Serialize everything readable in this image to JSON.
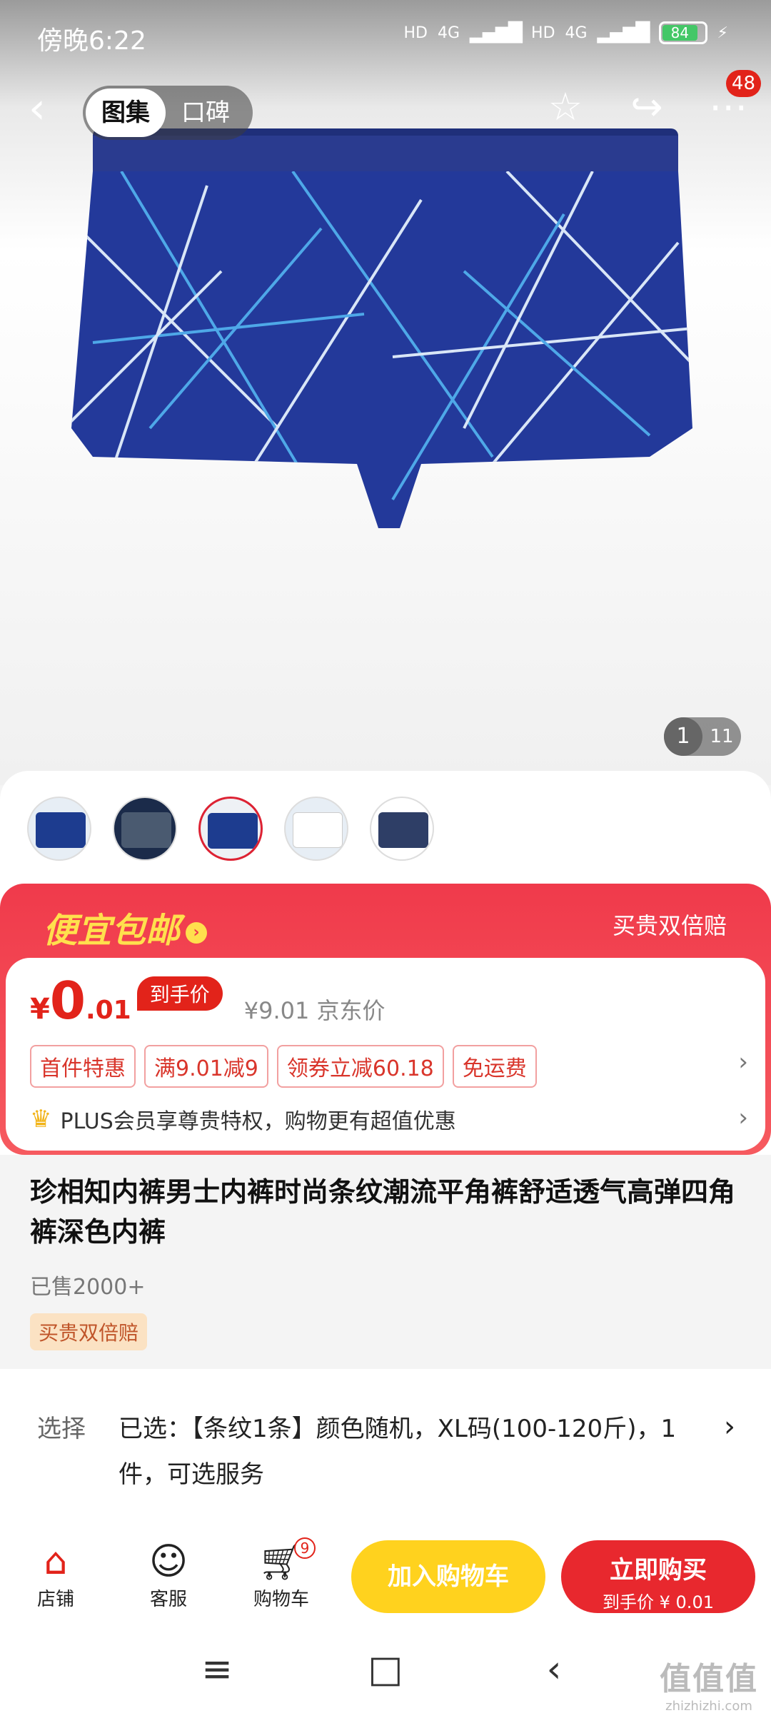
{
  "status": {
    "time": "傍晚6:22",
    "network1": "4G",
    "network2": "4G",
    "hd": "HD",
    "battery": "84"
  },
  "nav": {
    "back_icon": "back-arrow-icon",
    "tabs": [
      "图集",
      "口碑"
    ],
    "more_badge": "48"
  },
  "gallery": {
    "current": "1",
    "total": "11"
  },
  "promo": {
    "title": "便宜包邮",
    "right_text": "买贵双倍赔"
  },
  "price": {
    "yen": "¥",
    "integer": "0",
    "decimal": ".01",
    "pill": "到手价",
    "original": "¥9.01 京东价"
  },
  "tags": [
    "首件特惠",
    "满9.01减9",
    "领券立减60.18",
    "免运费"
  ],
  "plus_text": "PLUS会员享尊贵特权，购物更有超值优惠",
  "product": {
    "title": "珍相知内裤男士内裤时尚条纹潮流平角裤舒适透气高弹四角裤深色内裤",
    "sold": "已售2000+",
    "guarantee": "买贵双倍赔"
  },
  "selection": {
    "label": "选择",
    "text": "已选：【条纹1条】颜色随机，XL码(100-120斤)，1件，可选服务"
  },
  "bottom": {
    "shop": "店铺",
    "service": "客服",
    "cart": "购物车",
    "cart_count": "9",
    "add_cart": "加入购物车",
    "buy_now": "立即购买",
    "buy_sub": "到手价 ¥ 0.01"
  },
  "watermark": {
    "big": "值值值",
    "small": "zhizhizhi.com"
  },
  "colors": {
    "brand_red": "#e2231a",
    "cart_yellow": "#ffd21e",
    "promo_yellow": "#ffe04d"
  }
}
